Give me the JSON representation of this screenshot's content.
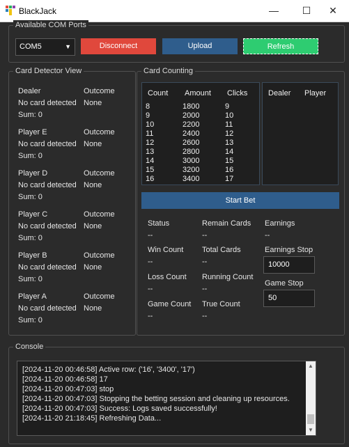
{
  "window": {
    "title": "BlackJack",
    "minimize": "—",
    "maximize": "☐",
    "close": "✕"
  },
  "com": {
    "group_title": "Available COM Ports",
    "selected_port": "COM5",
    "disconnect_label": "Disconnect",
    "upload_label": "Upload",
    "refresh_label": "Refresh"
  },
  "detector": {
    "group_title": "Card Detector View",
    "outcome_header": "Outcome",
    "players": [
      {
        "name": "Dealer",
        "status": "No card detected",
        "outcome": "None",
        "sum": "Sum: 0"
      },
      {
        "name": "Player E",
        "status": "No card detected",
        "outcome": "None",
        "sum": "Sum: 0"
      },
      {
        "name": "Player D",
        "status": "No card detected",
        "outcome": "None",
        "sum": "Sum: 0"
      },
      {
        "name": "Player C",
        "status": "No card detected",
        "outcome": "None",
        "sum": "Sum: 0"
      },
      {
        "name": "Player B",
        "status": "No card detected",
        "outcome": "None",
        "sum": "Sum: 0"
      },
      {
        "name": "Player A",
        "status": "No card detected",
        "outcome": "None",
        "sum": "Sum: 0"
      }
    ]
  },
  "counting": {
    "group_title": "Card Counting",
    "headers": [
      "Count",
      "Amount",
      "Clicks"
    ],
    "rows": [
      [
        "8",
        "1800",
        "9"
      ],
      [
        "9",
        "2000",
        "10"
      ],
      [
        "10",
        "2200",
        "11"
      ],
      [
        "11",
        "2400",
        "12"
      ],
      [
        "12",
        "2600",
        "13"
      ],
      [
        "13",
        "2800",
        "14"
      ],
      [
        "14",
        "3000",
        "15"
      ],
      [
        "15",
        "3200",
        "16"
      ],
      [
        "16",
        "3400",
        "17"
      ]
    ],
    "side_headers": [
      "Dealer",
      "Player"
    ],
    "start_bet_label": "Start Bet",
    "stats": {
      "status": {
        "label": "Status",
        "value": "--"
      },
      "remain_cards": {
        "label": "Remain Cards",
        "value": "--"
      },
      "earnings": {
        "label": "Earnings",
        "value": "--"
      },
      "win_count": {
        "label": "Win Count",
        "value": "--"
      },
      "total_cards": {
        "label": "Total Cards",
        "value": "--"
      },
      "loss_count": {
        "label": "Loss Count",
        "value": "--"
      },
      "running_count": {
        "label": "Running Count",
        "value": "--"
      },
      "game_count": {
        "label": "Game Count",
        "value": "--"
      },
      "true_count": {
        "label": "True Count",
        "value": "--"
      }
    },
    "earnings_stop": {
      "label": "Earnings Stop",
      "value": "10000"
    },
    "game_stop": {
      "label": "Game Stop",
      "value": "50"
    }
  },
  "console": {
    "group_title": "Console",
    "lines": [
      "[2024-11-20 00:46:58] Active row: ('16', '3400', '17')",
      "[2024-11-20 00:46:58] 17",
      "[2024-11-20 00:47:03] stop",
      "[2024-11-20 00:47:03] Stopping the betting session and cleaning up resources.",
      "[2024-11-20 00:47:03] Success: Logs saved successfully!",
      "[2024-11-20 21:18:45] Refreshing Data..."
    ]
  },
  "colors": {
    "disconnect": "#e0483c",
    "upload": "#2f5d8c",
    "refresh": "#2ecc71",
    "start_bet": "#2f5d8c"
  }
}
